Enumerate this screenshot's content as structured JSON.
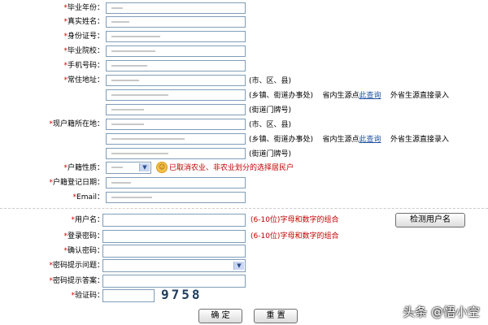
{
  "form": {
    "graduation_year": {
      "label": "毕业年份：",
      "value": ""
    },
    "real_name": {
      "label": "真实姓名：",
      "value": ""
    },
    "id_number": {
      "label": "身份证号：",
      "value": ""
    },
    "school": {
      "label": "毕业院校：",
      "value": ""
    },
    "mobile": {
      "label": "手机号码：",
      "value": ""
    },
    "home_address": {
      "label": "常住地址：",
      "suffix_city": "(市、区、县)",
      "suffix_town": "(乡镇、街道办事处)",
      "province_query_prefix": "省内生源点",
      "province_query_link": "此查询",
      "outside_direct": "外省生源直接录入",
      "suffix_street": "(街道门牌号)"
    },
    "household_address": {
      "label": "现户籍所在地：",
      "suffix_city": "(市、区、县)",
      "suffix_town": "(乡镇、街道办事处)",
      "province_query_prefix": "省内生源点",
      "province_query_link": "此查询",
      "outside_direct": "外省生源直接录入",
      "suffix_street": "(街道门牌号)"
    },
    "household_nature": {
      "label": "户籍性质：",
      "hint": "已取消农业、非农业划分的选择居民户"
    },
    "household_reg_date": {
      "label": "户籍登记日期："
    },
    "email": {
      "label": "Email："
    },
    "username": {
      "label": "用户名：",
      "rule": "(6-10位)字母和数字的组合",
      "check_button": "检测用户名"
    },
    "password": {
      "label": "登录密码：",
      "rule": "(6-10位)字母和数字的组合"
    },
    "confirm_password": {
      "label": "确认密码："
    },
    "security_question": {
      "label": "密码提示问题："
    },
    "security_answer": {
      "label": "密码提示答案："
    },
    "captcha": {
      "label": "验证码：",
      "code": "9758"
    }
  },
  "buttons": {
    "confirm": "确 定",
    "reset": "重 置"
  },
  "watermark": "头条 @悟小空",
  "colors": {
    "required": "#d40000",
    "link": "#1d4fa0",
    "input_border": "#7f9db9"
  }
}
